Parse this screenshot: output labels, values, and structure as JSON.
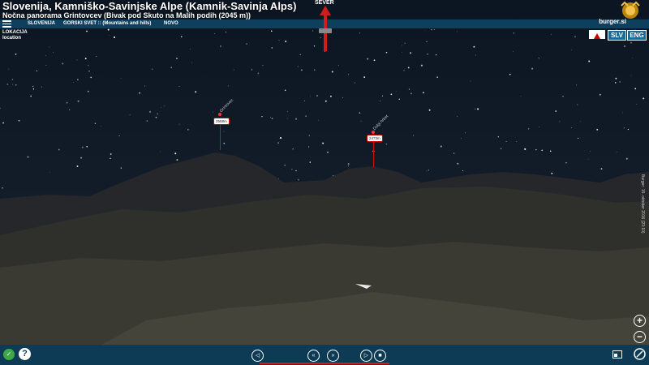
{
  "header": {
    "title": "Slovenija, Kamniško-Savinjske Alpe (Kamnik-Savinja Alps)",
    "subtitle": "Nočna panorama Grintovcev (Bivak pod Skuto na Malih podih (2045 m))",
    "brand": "burger.si"
  },
  "menu": {
    "items": [
      "SLOVENIJA",
      "GORSKI SVET :: (Mountains and hills)",
      "NOVO"
    ]
  },
  "compass": {
    "north_label": "SEVER"
  },
  "location": {
    "label_sl": "LOKACIJA",
    "label_en": "location"
  },
  "languages": {
    "slv": "SLV",
    "eng": "ENG"
  },
  "peaks": [
    {
      "name": "Grintovec",
      "elevation": "2558m"
    },
    {
      "name": "Dolgi hrbet",
      "elevation": "2473m"
    }
  ],
  "side_caption": "Burger: 15. oktober 2016 (23:10)",
  "zoom": {
    "in": "+",
    "out": "−"
  },
  "controls": {
    "sound": "◁",
    "prev": "«",
    "next": "»",
    "play": "▷",
    "stop": "■"
  },
  "colors": {
    "accent": "#1c6a95",
    "bar": "#0d3a55",
    "marker": "#d01010"
  }
}
